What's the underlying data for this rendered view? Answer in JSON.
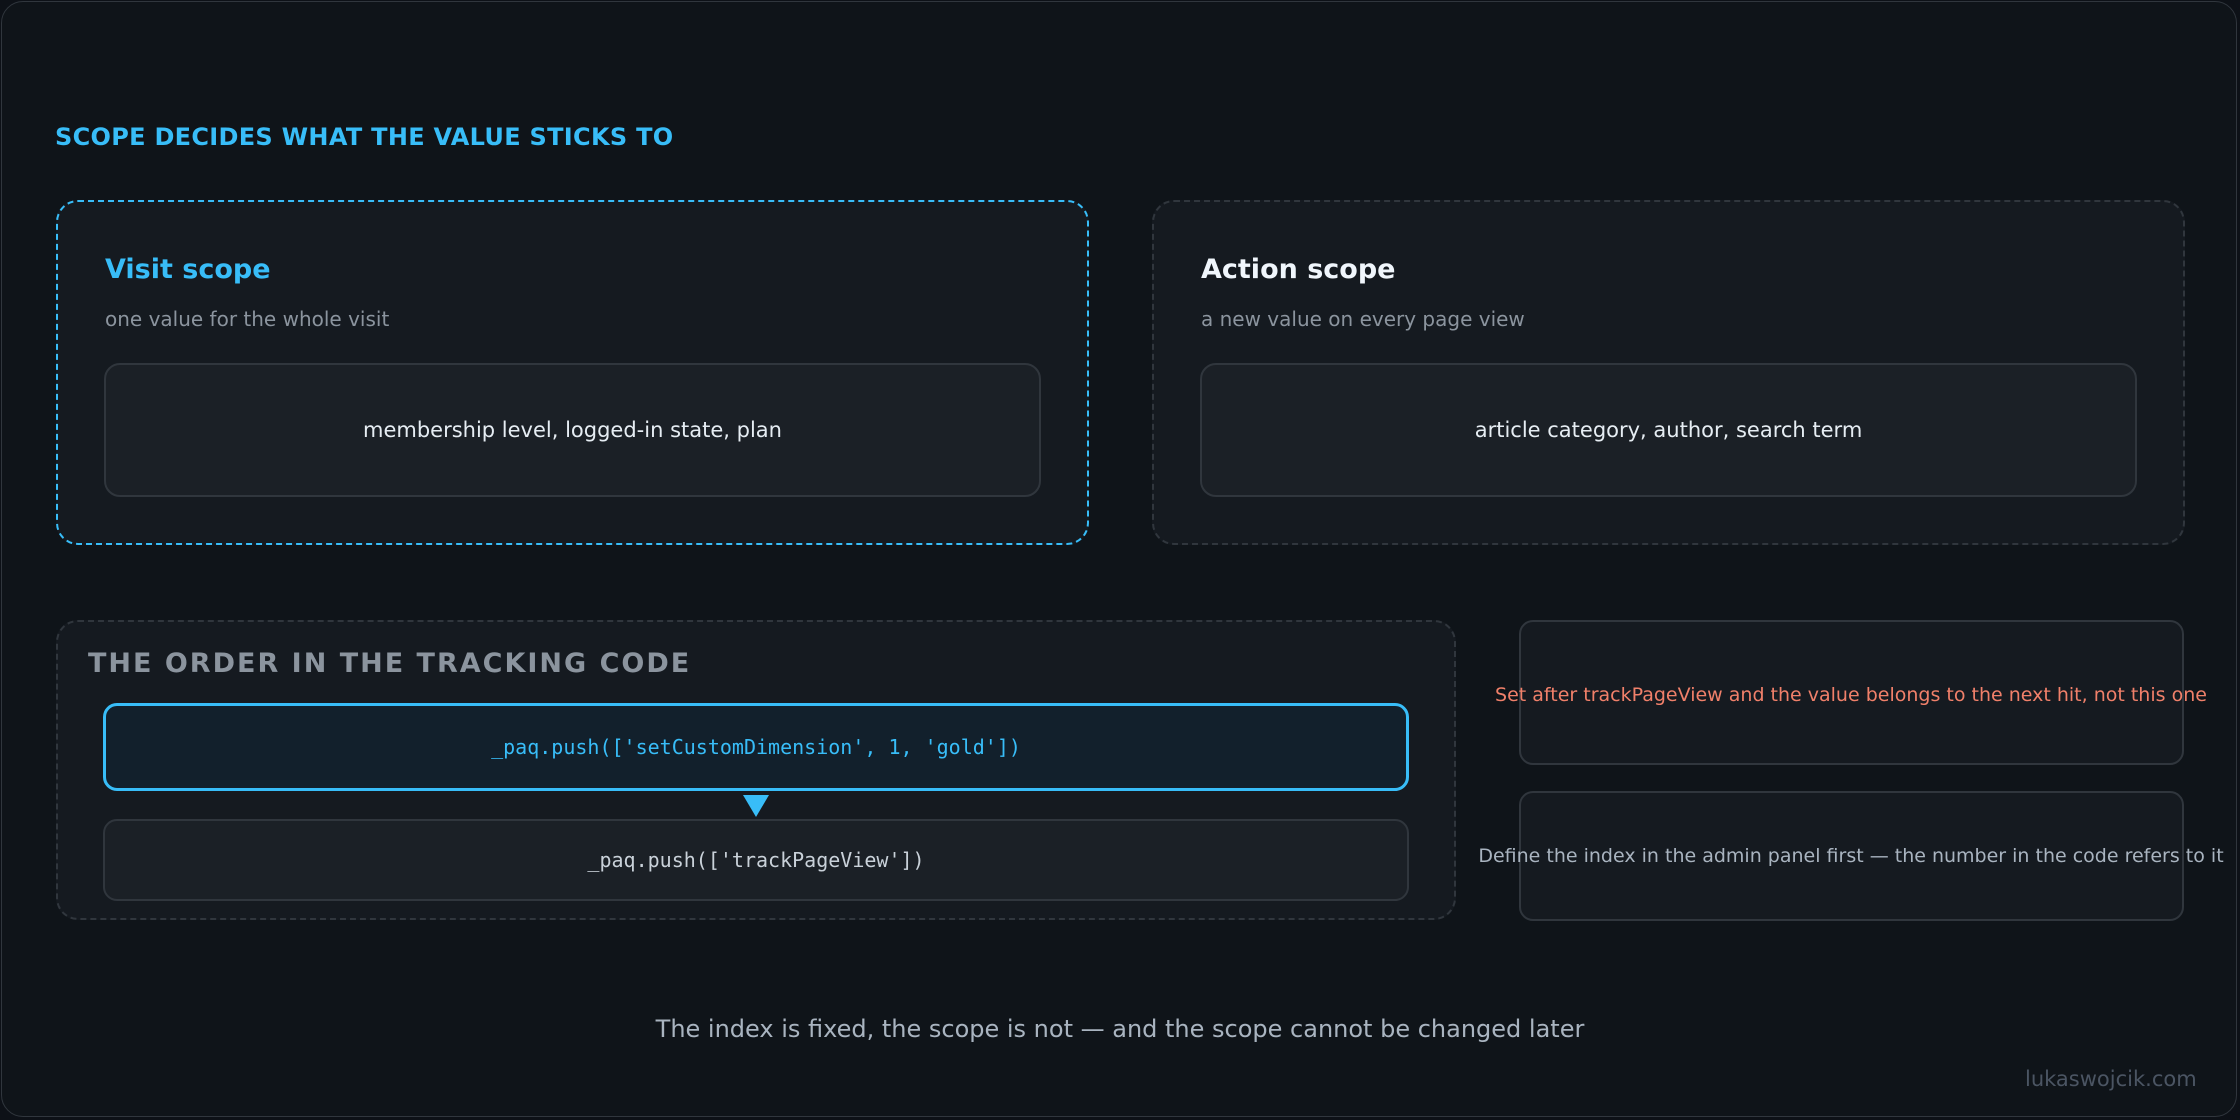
{
  "heading": "SCOPE DECIDES WHAT THE VALUE STICKS TO",
  "visit": {
    "title": "Visit scope",
    "subtitle": "one value for the whole visit",
    "examples": "membership level, logged-in state, plan"
  },
  "action": {
    "title": "Action scope",
    "subtitle": "a new value on every page view",
    "examples": "article category, author, search term"
  },
  "order": {
    "title": "THE ORDER IN THE TRACKING CODE",
    "line1": "_paq.push(['setCustomDimension', 1, 'gold'])",
    "line2": "_paq.push(['trackPageView'])"
  },
  "notes": {
    "warning": "Set after trackPageView and the value belongs to the next hit, not this one",
    "info": "Define the index in the admin panel first — the number in the code refers to it"
  },
  "footer": "The index is fixed, the scope is not — and the scope cannot be changed later",
  "credit": "lukaswojcik.com",
  "colors": {
    "accent": "#38bdf8",
    "warning": "#f0806a",
    "background": "#0f1419"
  }
}
